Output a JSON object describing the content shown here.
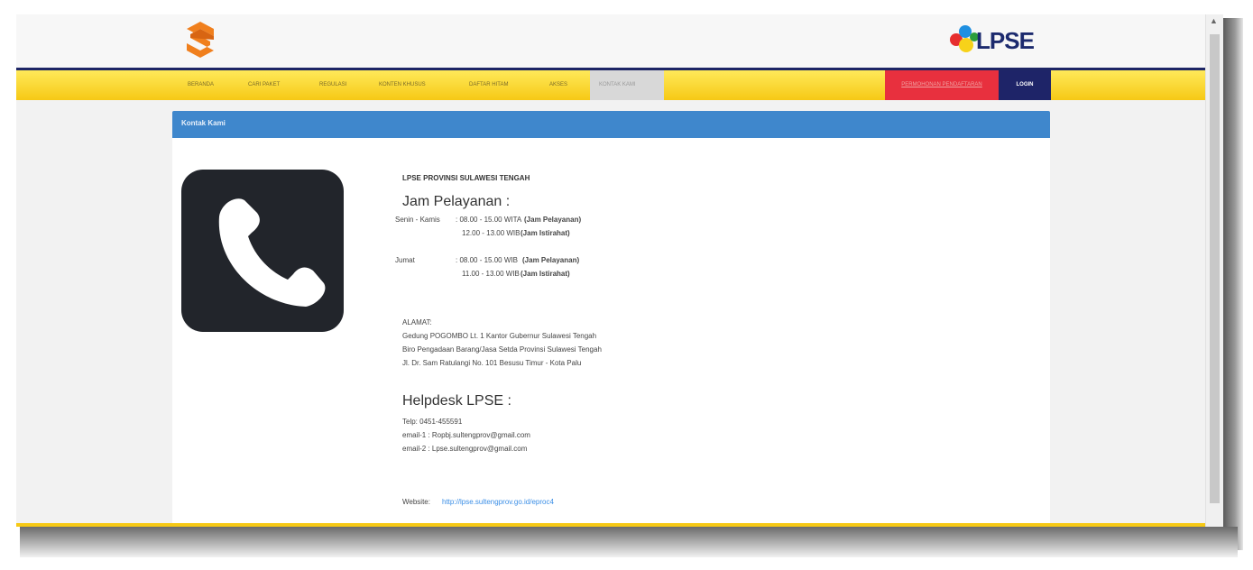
{
  "brand": {
    "left_logo_icon": "s-logo-icon",
    "right_logo_text": "LPSE",
    "colors": {
      "nav_yellow": "#f6c915",
      "nav_dark": "#1e2666",
      "panel_blue": "#3f87cc",
      "red": "#e8303e"
    }
  },
  "nav": {
    "items": [
      "BERANDA",
      "CARI PAKET",
      "REGULASI",
      "KONTEN KHUSUS",
      "DAFTAR HITAM",
      "AKSES",
      "KONTAK KAMI"
    ],
    "active": "KONTAK KAMI",
    "red_item": "PERMOHONAN PENDAFTARAN",
    "login": "LOGIN"
  },
  "panel": {
    "title": "Kontak Kami",
    "phone_icon": "phone-icon"
  },
  "contact": {
    "org_name": "LPSE PROVINSI SULAWESI TENGAH",
    "service_heading": "Jam Pelayanan :",
    "mon_thu_label": "Senin - Kamis",
    "mon_thu_line1_time": ": 08.00 - 15.00 WITA",
    "mon_thu_line1_tag": "(Jam Pelayanan)",
    "mon_thu_line2_time": "12.00 - 13.00 WIB",
    "mon_thu_line2_tag": "(Jam Istirahat)",
    "fri_label": "Jumat",
    "fri_line1_time": ": 08.00 - 15.00 WIB",
    "fri_line1_tag": "(Jam Pelayanan)",
    "fri_line2_time": "11.00 - 13.00 WIB",
    "fri_line2_tag": "(Jam Istirahat)",
    "address_label": "ALAMAT:",
    "address_lines": [
      "Gedung POGOMBO Lt. 1 Kantor Gubernur Sulawesi Tengah",
      "Biro Pengadaan Barang/Jasa Setda Provinsi Sulawesi Tengah",
      "Jl. Dr. Sam Ratulangi No. 101 Besusu Timur - Kota Palu"
    ],
    "helpdesk_heading": "Helpdesk LPSE :",
    "helpdesk_lines": [
      "Telp: 0451-455591",
      "email-1 : Ropbj.sultengprov@gmail.com",
      "email-2 : Lpse.sultengprov@gmail.com"
    ],
    "website_label": "Website:",
    "website_url": "http://lpse.sultengprov.go.id/eproc4"
  }
}
